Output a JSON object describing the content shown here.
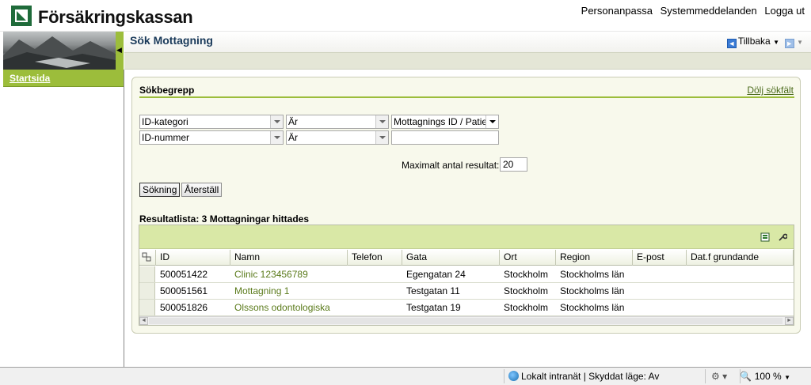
{
  "header": {
    "logo_text": "Försäkringskassan",
    "links": [
      "Personanpassa",
      "Systemmeddelanden",
      "Logga ut"
    ]
  },
  "sidebar": {
    "items": [
      {
        "label": "Startsida"
      }
    ]
  },
  "titlebar": {
    "title": "Sök Mottagning",
    "back_label": "Tillbaka"
  },
  "search": {
    "section_title": "Sökbegrepp",
    "hide_link": "Dölj sökfält",
    "row1": {
      "field": "ID-kategori",
      "operator": "Är",
      "value": "Mottagnings ID / Patie"
    },
    "row2": {
      "field": "ID-nummer",
      "operator": "Är",
      "value": ""
    },
    "max_results_label": "Maximalt antal resultat:",
    "max_results_value": "20",
    "search_button": "Sökning",
    "reset_button": "Återställ"
  },
  "results": {
    "summary": "Resultatlista: 3 Mottagningar hittades",
    "columns": [
      "ID",
      "Namn",
      "Telefon",
      "Gata",
      "Ort",
      "Region",
      "E-post",
      "Dat.f grundande"
    ],
    "rows": [
      {
        "id": "500051422",
        "name": "Clinic 123456789",
        "phone": "",
        "street": "Egengatan 24",
        "city": "Stockholm",
        "region": "Stockholms län",
        "email": "",
        "founded": ""
      },
      {
        "id": "500051561",
        "name": "Mottagning 1",
        "phone": "",
        "street": "Testgatan 11",
        "city": "Stockholm",
        "region": "Stockholms län",
        "email": "",
        "founded": ""
      },
      {
        "id": "500051826",
        "name": "Olssons odontologiska",
        "phone": "",
        "street": "Testgatan 19",
        "city": "Stockholm",
        "region": "Stockholms län",
        "email": "",
        "founded": ""
      }
    ]
  },
  "statusbar": {
    "zone": "Lokalt intranät | Skyddat läge: Av",
    "zoom": "100 %"
  },
  "colors": {
    "accent_green": "#9cbd3b",
    "link_green": "#5a7a1a",
    "logo_green": "#1f6b3a"
  }
}
